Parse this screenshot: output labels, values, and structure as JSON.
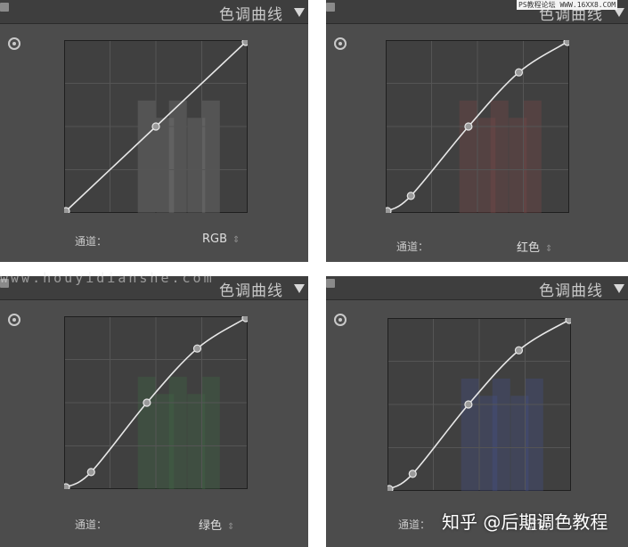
{
  "panels": [
    {
      "title": "色调曲线",
      "channel_label": "通道：",
      "channel_value": "RGB",
      "curve_points": [
        [
          0,
          0
        ],
        [
          0.5,
          0.5
        ],
        [
          1,
          1
        ]
      ],
      "histogram_tint": "#7a7a7a"
    },
    {
      "title": "色调曲线",
      "channel_label": "通道：",
      "channel_value": "红色",
      "curve_points": [
        [
          0,
          0
        ],
        [
          0.13,
          0.09
        ],
        [
          0.45,
          0.5
        ],
        [
          0.73,
          0.82
        ],
        [
          1,
          1
        ]
      ],
      "histogram_tint": "#7a4747"
    },
    {
      "title": "色调曲线",
      "channel_label": "通道：",
      "channel_value": "绿色",
      "curve_points": [
        [
          0,
          0
        ],
        [
          0.14,
          0.09
        ],
        [
          0.45,
          0.5
        ],
        [
          0.73,
          0.82
        ],
        [
          1,
          1
        ]
      ],
      "histogram_tint": "#3f6a45"
    },
    {
      "title": "色调曲线",
      "channel_label": "通道：",
      "channel_value": "蓝色",
      "curve_points": [
        [
          0,
          0
        ],
        [
          0.13,
          0.09
        ],
        [
          0.44,
          0.5
        ],
        [
          0.72,
          0.82
        ],
        [
          1,
          1
        ]
      ],
      "histogram_tint": "#45508a"
    }
  ],
  "watermarks": {
    "top_right": "PS教程论坛 WWW.16XX8.COM",
    "middle": "www.houyidianshe.com",
    "bottom_right": "知乎 @后期调色教程"
  },
  "colors": {
    "panel_bg": "#4c4c4c",
    "plot_bg": "#404040",
    "curve": "#e8e8e8"
  }
}
